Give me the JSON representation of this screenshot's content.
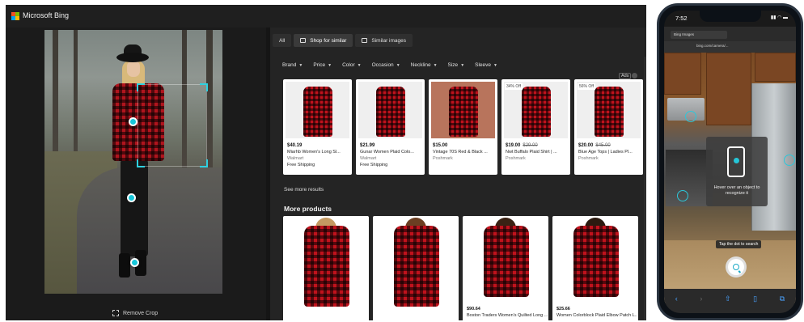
{
  "header": {
    "brand": "Microsoft Bing",
    "logo_colors": [
      "#f25022",
      "#7fba00",
      "#00a4ef",
      "#ffb900"
    ]
  },
  "left": {
    "remove_crop_label": "Remove Crop"
  },
  "tabs": [
    {
      "label": "All"
    },
    {
      "label": "Shop for similar",
      "icon": "shopping-bag-icon"
    },
    {
      "label": "Similar images",
      "icon": "image-icon"
    }
  ],
  "filters": [
    "Brand",
    "Price",
    "Color",
    "Occasion",
    "Neckline",
    "Size",
    "Sleeve"
  ],
  "ads_label": "Ads",
  "shop_items": [
    {
      "price": "$40.19",
      "old_price": "",
      "badge": "",
      "title": "Miarhb Women's Long Sl...",
      "store": "Walmart",
      "shipping": "Free Shipping"
    },
    {
      "price": "$21.99",
      "old_price": "",
      "badge": "",
      "title": "Gunar Women Plaid Colo...",
      "store": "Walmart",
      "shipping": "Free Shipping"
    },
    {
      "price": "$15.00",
      "old_price": "",
      "badge": "",
      "title": "Vintage 70S Red & Black ...",
      "store": "Poshmark",
      "shipping": ""
    },
    {
      "price": "$19.00",
      "old_price": "$29.00",
      "badge": "34% Off",
      "title": "Nwt Buffalo Plaid Shirt | ...",
      "store": "Poshmark",
      "shipping": ""
    },
    {
      "price": "$20.00",
      "old_price": "$45.00",
      "badge": "56% Off",
      "title": "Blue Age Tops | Ladies Pl...",
      "store": "Poshmark",
      "shipping": ""
    }
  ],
  "see_more": "See more results",
  "more_products_heading": "More products",
  "more_products": [
    {
      "price": "",
      "title": ""
    },
    {
      "price": "",
      "title": ""
    },
    {
      "price": "$90.64",
      "title": "Boston Traders Women's Quilted Long ..."
    },
    {
      "price": "$25.66",
      "title": "Women Colorblock Plaid Elbow Patch L..."
    }
  ],
  "phone": {
    "time": "7:52",
    "tab_title": "Bing Images",
    "url": "bing.com/camera/...",
    "hint": "Hover over an object to recognize it",
    "tap_tip": "Tap the dot to search"
  }
}
